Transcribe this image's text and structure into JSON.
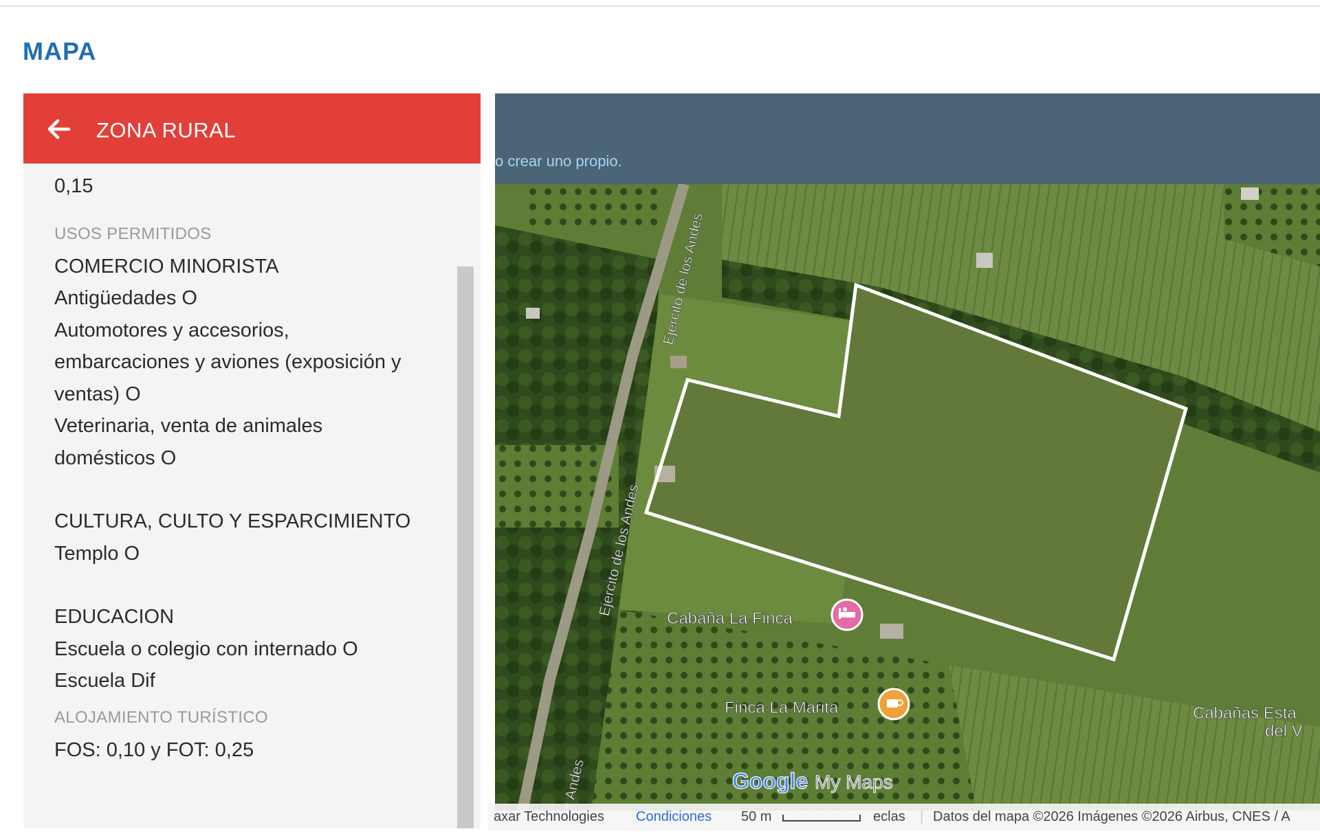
{
  "page": {
    "title": "MAPA"
  },
  "panel": {
    "header_title": "ZONA RURAL",
    "intro_value": "0,15",
    "usos_label": "USOS PERMITIDOS",
    "groups": [
      {
        "heading": "COMERCIO MINORISTA",
        "lines": [
          "Antigüedades O",
          "Automotores y accesorios,",
          "embarcaciones y aviones (exposición y",
          "ventas) O",
          "Veterinaria, venta de animales",
          "domésticos O"
        ]
      },
      {
        "heading": "CULTURA, CULTO Y ESPARCIMIENTO",
        "lines": [
          "Templo O"
        ]
      },
      {
        "heading": "EDUCACION",
        "lines": [
          "Escuela o colegio con internado O",
          "Escuela Dif"
        ]
      }
    ],
    "alojamiento_label": "ALOJAMIENTO TURÍSTICO",
    "alojamiento_value": "FOS: 0,10 y FOT: 0,25"
  },
  "map": {
    "hint_text": "o crear uno propio.",
    "road_label_1": "Ejercito de los Andes",
    "road_label_2": "Ejercito de los Andes",
    "road_label_3": "s Andes",
    "poi_1": "Cabaña La Finca",
    "poi_2": "Finca La Marita",
    "poi_3_line1": "Cabañas Esta",
    "poi_3_line2": "del V",
    "logo_google": "Google",
    "logo_mymaps": "My Maps",
    "attribution": {
      "provider": "axar Technologies",
      "terms": "Condiciones",
      "scale": "50 m",
      "shortcuts": "eclas",
      "data": "Datos del mapa ©2026 Imágenes ©2026 Airbus, CNES / A"
    },
    "colors": {
      "parcel_outline": "#ffffff",
      "header_bg": "#4b6476",
      "panel_header": "#e23f38"
    }
  }
}
